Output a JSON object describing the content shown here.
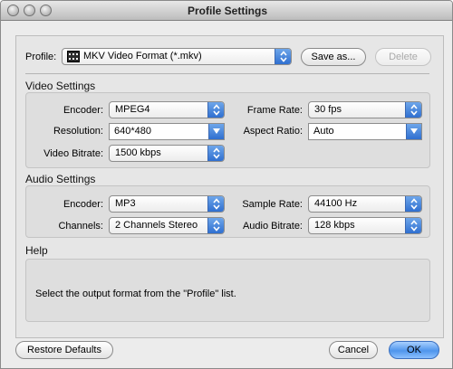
{
  "window": {
    "title": "Profile Settings"
  },
  "profile": {
    "label": "Profile:",
    "value": "MKV Video Format (*.mkv)",
    "save_as": "Save as...",
    "delete": "Delete"
  },
  "video": {
    "title": "Video Settings",
    "encoder_label": "Encoder:",
    "encoder": "MPEG4",
    "resolution_label": "Resolution:",
    "resolution": "640*480",
    "bitrate_label": "Video Bitrate:",
    "bitrate": "1500 kbps",
    "framerate_label": "Frame Rate:",
    "framerate": "30 fps",
    "aspect_label": "Aspect Ratio:",
    "aspect": "Auto"
  },
  "audio": {
    "title": "Audio Settings",
    "encoder_label": "Encoder:",
    "encoder": "MP3",
    "channels_label": "Channels:",
    "channels": "2 Channels Stereo",
    "samplerate_label": "Sample Rate:",
    "samplerate": "44100 Hz",
    "bitrate_label": "Audio Bitrate:",
    "bitrate": "128 kbps"
  },
  "help": {
    "title": "Help",
    "text": "Select the output format from the \"Profile\" list."
  },
  "footer": {
    "restore": "Restore Defaults",
    "cancel": "Cancel",
    "ok": "OK"
  },
  "colors": {
    "accent": "#3b7ddd",
    "window_bg": "#ececec"
  },
  "icons": {
    "traffic_lights": "window-control-buttons",
    "popup_arrows": "up-down-chevron-icon",
    "combo_arrow": "chevron-down-icon",
    "profile": "video-format-icon"
  }
}
